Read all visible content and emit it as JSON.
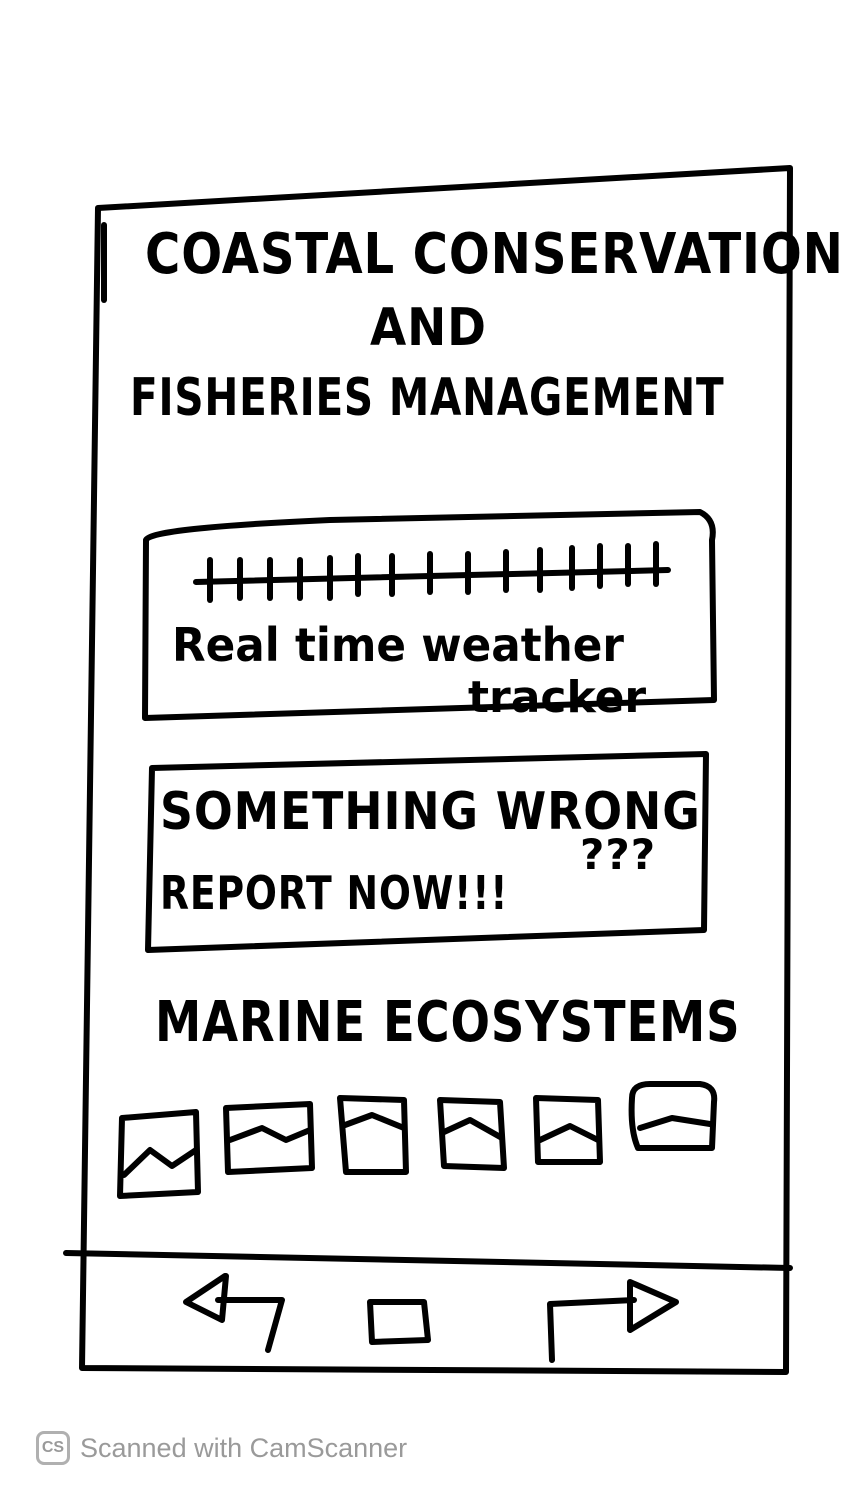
{
  "app": {
    "title_lines": [
      "COASTAL CONSERVATION",
      "AND",
      "FISHERIES MANAGEMENT"
    ]
  },
  "weather_tracker": {
    "label_line_1": "Real time weather",
    "label_line_2": "tracker"
  },
  "report": {
    "line_1": "SOMETHING WRONG",
    "line_2": "???",
    "line_3": "REPORT NOW!!!"
  },
  "marine_ecosystems": {
    "section_title": "MARINE ECOSYSTEMS",
    "thumbnails": [
      {
        "icon": "image-placeholder-icon"
      },
      {
        "icon": "image-placeholder-icon"
      },
      {
        "icon": "image-placeholder-icon"
      },
      {
        "icon": "image-placeholder-icon"
      },
      {
        "icon": "image-placeholder-icon"
      },
      {
        "icon": "image-placeholder-icon"
      }
    ]
  },
  "nav_bar": {
    "back_icon": "back-arrow-icon",
    "home_icon": "home-icon",
    "forward_icon": "forward-arrow-icon"
  },
  "watermark": {
    "logo_text": "CS",
    "text": "Scanned with CamScanner"
  },
  "colors": {
    "ink": "#000000",
    "paper": "#ffffff",
    "watermark": "#9a9a9a"
  }
}
